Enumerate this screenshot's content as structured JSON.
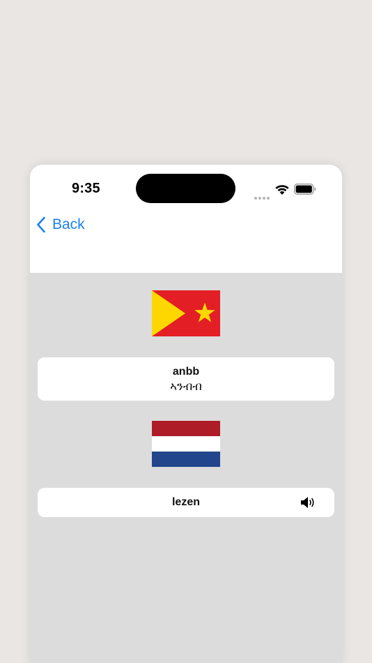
{
  "status_bar": {
    "time": "9:35"
  },
  "nav": {
    "back_label": "Back"
  },
  "source": {
    "flag_icon": "tigray-flag-icon",
    "word": "anbb",
    "native_word": "ኣንብብ"
  },
  "target": {
    "flag_icon": "netherlands-flag-icon",
    "word": "lezen",
    "speaker_icon": "speaker-icon"
  },
  "colors": {
    "accent": "#1a82f0",
    "header_bg": "#ffffff",
    "content_bg": "#dcdcdc",
    "card_bg": "#ffffff"
  }
}
